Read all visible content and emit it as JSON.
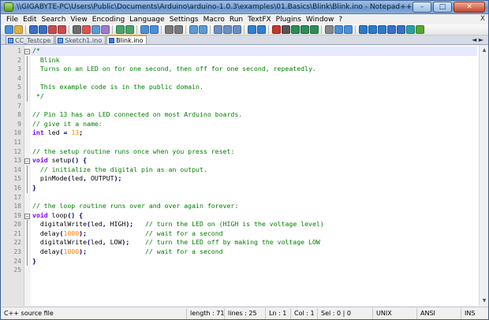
{
  "window": {
    "title": "\\\\GIGABYTE-PC\\Users\\Public\\Documents\\Arduino\\arduino-1.0.3\\examples\\01.Basics\\Blink\\Blink.ino - Notepad++",
    "buttons": {
      "minimize": "–",
      "maximize": "□",
      "close": "✕"
    }
  },
  "menu": {
    "items": [
      "File",
      "Edit",
      "Search",
      "View",
      "Encoding",
      "Language",
      "Settings",
      "Macro",
      "Run",
      "TextFX",
      "Plugins",
      "Window",
      "?"
    ],
    "close_glyph": "X"
  },
  "toolbar": {
    "icons": [
      "new-file-icon",
      "open-icon",
      "save-icon",
      "save-all-icon",
      "close-icon",
      "close-all-icon",
      "print-icon",
      "cut-icon",
      "copy-icon",
      "paste-icon",
      "undo-icon",
      "redo-icon",
      "find-icon",
      "replace-icon",
      "zoom-in-icon",
      "zoom-out-icon",
      "sync-v-icon",
      "sync-h-icon",
      "wrap-icon",
      "all-chars-icon",
      "indent-guide-icon",
      "doc-map-icon",
      "function-list-icon",
      "record-macro-icon",
      "stop-macro-icon",
      "play-macro-icon",
      "run-macro-icon",
      "save-macro-icon",
      "trim-icon",
      "spell-icon",
      "compare-icon",
      "prev-icon",
      "next-icon",
      "bookmark-icon",
      "fold-icon",
      "unfold-icon",
      "encode-icon",
      "lint-icon"
    ]
  },
  "tabs": [
    {
      "label": "CC_Testcpe",
      "active": false
    },
    {
      "label": "Sketch1.ino",
      "active": false
    },
    {
      "label": "Blink.ino",
      "active": true
    }
  ],
  "tabs_scroll": "◄ ►",
  "editor": {
    "lines": [
      {
        "n": "1",
        "fold": "−",
        "parts": [
          [
            "c-comment",
            "/*"
          ]
        ]
      },
      {
        "n": "2",
        "parts": [
          [
            "c-comment",
            "  Blink"
          ]
        ]
      },
      {
        "n": "3",
        "parts": [
          [
            "c-comment",
            "  Turns on an LED on for one second, then off for one second, repeatedly."
          ]
        ]
      },
      {
        "n": "4",
        "parts": [
          [
            "c-comment",
            ""
          ]
        ]
      },
      {
        "n": "5",
        "parts": [
          [
            "c-comment",
            "  This example code is in the public domain."
          ]
        ]
      },
      {
        "n": "6",
        "parts": [
          [
            "c-comment",
            " */"
          ]
        ]
      },
      {
        "n": "7",
        "parts": [
          [
            "c-plain",
            ""
          ]
        ]
      },
      {
        "n": "8",
        "parts": [
          [
            "c-comment",
            "// Pin 13 has an LED connected on most Arduino boards."
          ]
        ]
      },
      {
        "n": "9",
        "parts": [
          [
            "c-comment",
            "// give it a name:"
          ]
        ]
      },
      {
        "n": "10",
        "parts": [
          [
            "c-type",
            "int"
          ],
          [
            "c-plain",
            " led "
          ],
          [
            "c-op",
            "="
          ],
          [
            "c-plain",
            " "
          ],
          [
            "c-num",
            "13"
          ],
          [
            "c-op",
            ";"
          ]
        ]
      },
      {
        "n": "11",
        "parts": [
          [
            "c-plain",
            ""
          ]
        ]
      },
      {
        "n": "12",
        "parts": [
          [
            "c-comment",
            "// the setup routine runs once when you press reset:"
          ]
        ]
      },
      {
        "n": "13",
        "fold": "−",
        "parts": [
          [
            "c-type",
            "void"
          ],
          [
            "c-plain",
            " setup"
          ],
          [
            "c-op",
            "()"
          ],
          [
            "c-plain",
            " "
          ],
          [
            "c-op",
            "{"
          ]
        ]
      },
      {
        "n": "14",
        "parts": [
          [
            "c-comment",
            "  // initialize the digital pin as an output."
          ]
        ]
      },
      {
        "n": "15",
        "parts": [
          [
            "c-plain",
            "  pinMode"
          ],
          [
            "c-op",
            "("
          ],
          [
            "c-plain",
            "led"
          ],
          [
            "c-op",
            ","
          ],
          [
            "c-plain",
            " OUTPUT"
          ],
          [
            "c-op",
            ");"
          ]
        ]
      },
      {
        "n": "16",
        "parts": [
          [
            "c-op",
            "}"
          ]
        ]
      },
      {
        "n": "17",
        "parts": [
          [
            "c-plain",
            ""
          ]
        ]
      },
      {
        "n": "18",
        "parts": [
          [
            "c-comment",
            "// the loop routine runs over and over again forever:"
          ]
        ]
      },
      {
        "n": "19",
        "fold": "−",
        "parts": [
          [
            "c-type",
            "void"
          ],
          [
            "c-plain",
            " loop"
          ],
          [
            "c-op",
            "()"
          ],
          [
            "c-plain",
            " "
          ],
          [
            "c-op",
            "{"
          ]
        ]
      },
      {
        "n": "20",
        "parts": [
          [
            "c-plain",
            "  digitalWrite"
          ],
          [
            "c-op",
            "("
          ],
          [
            "c-plain",
            "led"
          ],
          [
            "c-op",
            ","
          ],
          [
            "c-plain",
            " HIGH"
          ],
          [
            "c-op",
            ");"
          ],
          [
            "c-plain",
            "   "
          ],
          [
            "c-comment",
            "// turn the LED on (HIGH is the voltage level)"
          ]
        ]
      },
      {
        "n": "21",
        "parts": [
          [
            "c-plain",
            "  delay"
          ],
          [
            "c-op",
            "("
          ],
          [
            "c-num",
            "1000"
          ],
          [
            "c-op",
            ");"
          ],
          [
            "c-plain",
            "               "
          ],
          [
            "c-comment",
            "// wait for a second"
          ]
        ]
      },
      {
        "n": "22",
        "parts": [
          [
            "c-plain",
            "  digitalWrite"
          ],
          [
            "c-op",
            "("
          ],
          [
            "c-plain",
            "led"
          ],
          [
            "c-op",
            ","
          ],
          [
            "c-plain",
            " LOW"
          ],
          [
            "c-op",
            ");"
          ],
          [
            "c-plain",
            "    "
          ],
          [
            "c-comment",
            "// turn the LED off by making the voltage LOW"
          ]
        ]
      },
      {
        "n": "23",
        "parts": [
          [
            "c-plain",
            "  delay"
          ],
          [
            "c-op",
            "("
          ],
          [
            "c-num",
            "1000"
          ],
          [
            "c-op",
            ");"
          ],
          [
            "c-plain",
            "               "
          ],
          [
            "c-comment",
            "// wait for a second"
          ]
        ]
      },
      {
        "n": "24",
        "parts": [
          [
            "c-op",
            "}"
          ]
        ]
      },
      {
        "n": "25",
        "parts": [
          [
            "c-plain",
            ""
          ]
        ]
      }
    ]
  },
  "status": {
    "file_type": "C++ source file",
    "length": "length : 710",
    "lines": "lines : 25",
    "ln": "Ln : 1",
    "col": "Col : 1",
    "sel": "Sel : 0 | 0",
    "eol": "UNIX",
    "encoding": "ANSI",
    "mode": "INS"
  },
  "colors": {
    "comment": "#008000",
    "type_keyword": "#8000ff",
    "number": "#ff8000",
    "operator": "#000080",
    "current_line": "#e8e8ff",
    "active_tab_accent": "#f5a623"
  }
}
